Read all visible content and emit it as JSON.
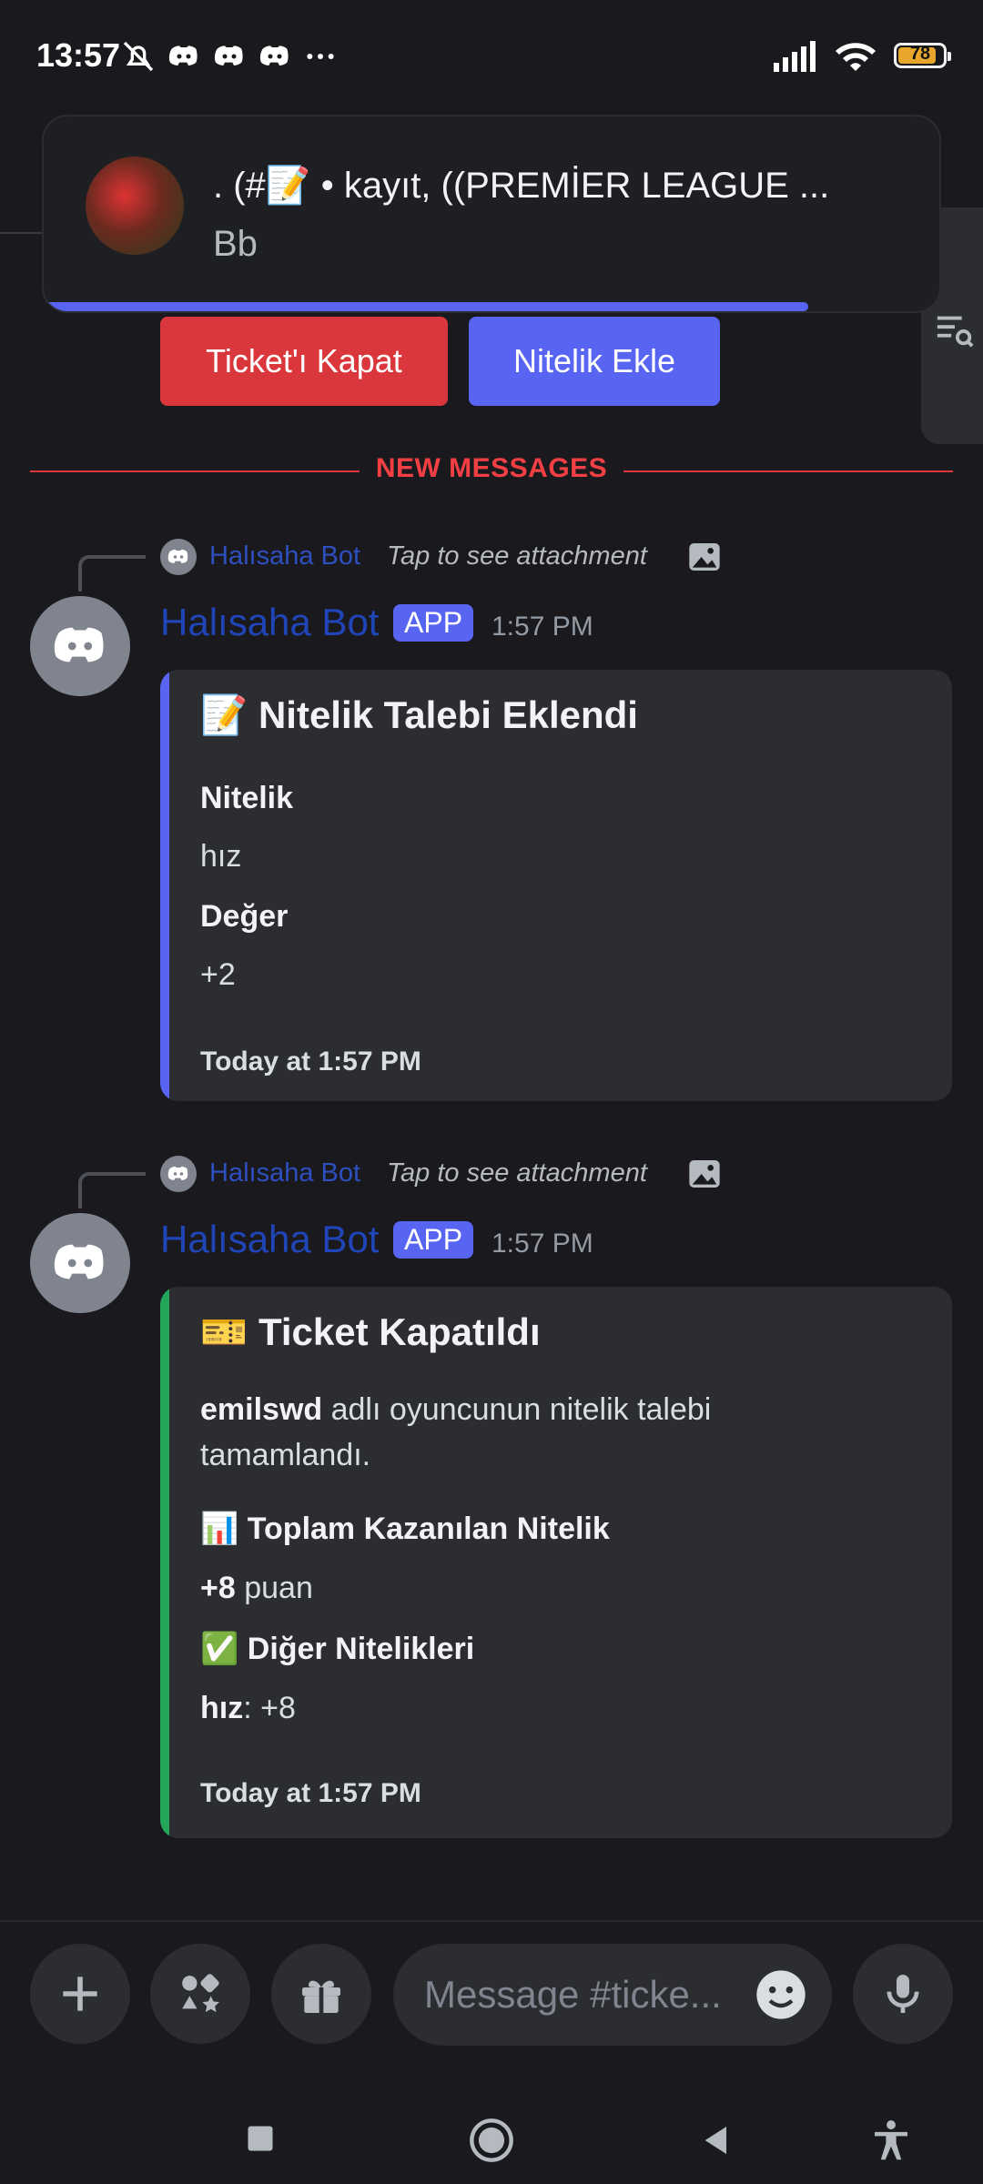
{
  "status_bar": {
    "time": "13:57",
    "battery_level": "78",
    "icons": [
      "bell-off-icon",
      "discord-icon",
      "discord-icon",
      "discord-icon",
      "more-dots-icon",
      "signal-icon",
      "wifi-icon",
      "battery-icon"
    ]
  },
  "notification": {
    "title": ". (#📝 • kayıt, ((PREMİER LEAGUE ...",
    "body": "Bb"
  },
  "top_buttons": {
    "close_ticket": "Ticket'ı Kapat",
    "add_attribute": "Nitelik Ekle"
  },
  "divider": {
    "label": "NEW MESSAGES"
  },
  "messages": [
    {
      "reply_name": "Halısaha Bot",
      "reply_text": "Tap to see attachment",
      "author": "Halısaha Bot",
      "badge": "APP",
      "time": "1:57 PM",
      "embed": {
        "color": "#5865f2",
        "title": "📝 Nitelik Talebi Eklendi",
        "fields": [
          {
            "name": "Nitelik",
            "value": "hız"
          },
          {
            "name": "Değer",
            "value": "+2"
          }
        ],
        "footer": "Today at 1:57 PM"
      }
    },
    {
      "reply_name": "Halısaha Bot",
      "reply_text": "Tap to see attachment",
      "author": "Halısaha Bot",
      "badge": "APP",
      "time": "1:57 PM",
      "embed": {
        "color": "#23a55a",
        "title": "🎫 Ticket Kapatıldı",
        "desc_bold": "emilswd",
        "desc_rest": " adlı oyuncunun nitelik talebi",
        "desc_line2": "tamamlandı.",
        "section1_title": "📊 Toplam Kazanılan Nitelik",
        "section1_bold": "+8",
        "section1_rest": " puan",
        "section2_title": "✅ Diğer Nitelikleri",
        "section2_bold": "hız",
        "section2_rest": ": +8",
        "footer": "Today at 1:57 PM"
      }
    }
  ],
  "composer": {
    "placeholder": "Message #ticke..."
  }
}
